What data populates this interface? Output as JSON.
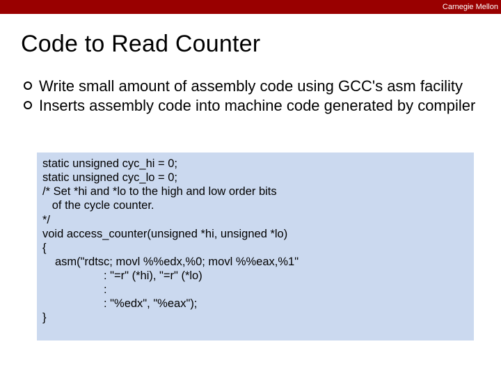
{
  "header": {
    "institution": "Carnegie Mellon"
  },
  "title": "Code to Read Counter",
  "bullets": [
    "Write small amount of assembly code using GCC's asm facility",
    "Inserts assembly code into machine code generated by compiler"
  ],
  "code": {
    "l0": "static unsigned cyc_hi = 0;",
    "l1": "static unsigned cyc_lo = 0;",
    "l2": "",
    "l3": "/* Set *hi and *lo to the high and low order bits",
    "l4": "   of the cycle counter.",
    "l5": "*/",
    "l6": "void access_counter(unsigned *hi, unsigned *lo)",
    "l7": "{",
    "l8": "asm(\"rdtsc; movl %%edx,%0; movl %%eax,%1\"",
    "l9": ": \"=r\" (*hi), \"=r\" (*lo)",
    "l10": ":",
    "l11": ": \"%edx\", \"%eax\");",
    "l12": "}"
  }
}
